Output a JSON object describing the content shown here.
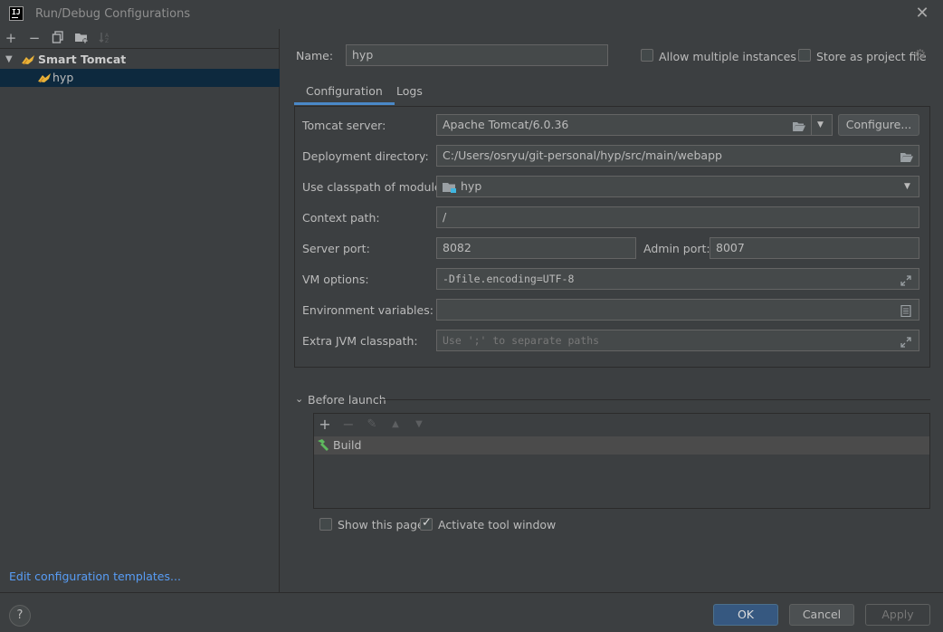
{
  "window": {
    "title": "Run/Debug Configurations",
    "app_icon_text": "IJ"
  },
  "left": {
    "toolbar": [
      "add-icon",
      "remove-icon",
      "copy-icon",
      "folder-add-icon",
      "sort-icon"
    ],
    "tree": {
      "group_label": "Smart Tomcat",
      "items": [
        {
          "label": "hyp",
          "selected": true
        }
      ]
    },
    "edit_templates": "Edit configuration templates..."
  },
  "header": {
    "name_label": "Name:",
    "name_value": "hyp",
    "allow_multiple": "Allow multiple instances",
    "store_project_file": "Store as project file"
  },
  "tabs": [
    {
      "label": "Configuration",
      "active": true
    },
    {
      "label": "Logs",
      "active": false
    }
  ],
  "config": {
    "tomcat_server_label": "Tomcat server:",
    "tomcat_server_value": "Apache Tomcat/6.0.36",
    "configure_button": "Configure...",
    "deploy_dir_label": "Deployment directory:",
    "deploy_dir_value": "C:/Users/osryu/git-personal/hyp/src/main/webapp",
    "classpath_label": "Use classpath of module:",
    "classpath_value": "hyp",
    "context_path_label": "Context path:",
    "context_path_value": "/",
    "server_port_label": "Server port:",
    "server_port_value": "8082",
    "admin_port_label": "Admin port:",
    "admin_port_value": "8007",
    "vm_options_label": "VM options:",
    "vm_options_value": "-Dfile.encoding=UTF-8",
    "env_vars_label": "Environment variables:",
    "env_vars_value": "",
    "extra_jvm_label": "Extra JVM classpath:",
    "extra_jvm_placeholder": "Use ';' to separate paths"
  },
  "before_launch": {
    "title": "Before launch",
    "items": [
      {
        "label": "Build"
      }
    ],
    "show_this_page": "Show this page",
    "activate_tool_window": "Activate tool window",
    "show_this_page_checked": false,
    "activate_tool_window_checked": true
  },
  "footer": {
    "help": "?",
    "ok": "OK",
    "cancel": "Cancel",
    "apply": "Apply"
  },
  "colors": {
    "accent": "#4a88c7",
    "selection": "#0d293e",
    "link": "#589df6",
    "primary_button": "#365880"
  }
}
